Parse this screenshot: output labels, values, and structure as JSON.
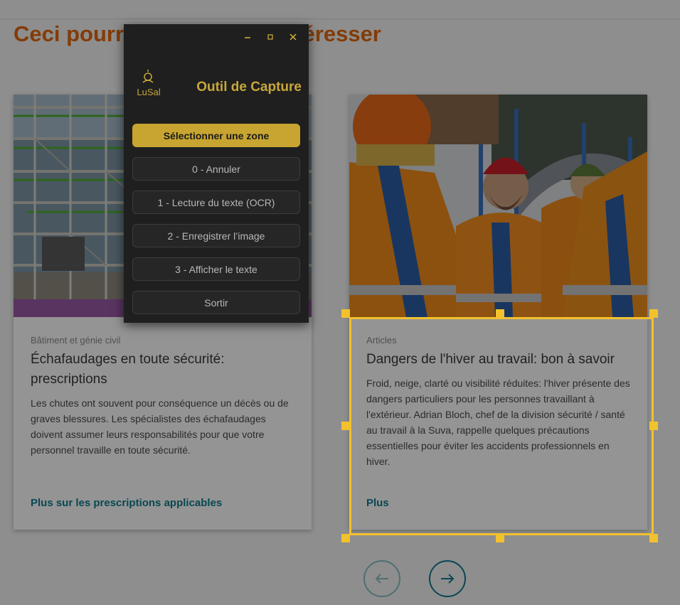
{
  "section": {
    "title": "Ceci pourrait aussi vous intéresser"
  },
  "cards": [
    {
      "category": "Bâtiment et génie civil",
      "title": "Échafaudages en toute sécurité: prescriptions",
      "text": "Les chutes ont souvent pour conséquence un décès ou de graves blessures. Les spécialistes des échafaudages doivent assumer leurs responsabilités pour que votre personnel travaille en toute sécurité.",
      "link": "Plus sur les prescriptions applicables",
      "image": "scaffolding-building-photo"
    },
    {
      "category": "Articles",
      "title": "Dangers de l'hiver au travail: bon à savoir",
      "text": "Froid, neige, clarté ou visibilité réduites: l'hiver présente des dangers particuliers pour les personnes travaillant à l'extérieur. Adrian Bloch, chef de la division sécurité / santé au travail à la Suva, rappelle quelques précautions essentielles pour éviter les accidents professionnels en hiver.",
      "link": "Plus",
      "image": "winter-workers-photo"
    }
  ],
  "carousel": {
    "prev_icon": "arrow-left-icon",
    "next_icon": "arrow-right-icon"
  },
  "capture_tool": {
    "brand": "LuSal",
    "title": "Outil de Capture",
    "buttons": {
      "select": "Sélectionner une zone",
      "cancel": "0 - Annuler",
      "ocr": "1 - Lecture du texte (OCR)",
      "save": "2 - Enregistrer l’image",
      "show": "3 - Afficher le texte",
      "exit": "Sortir"
    },
    "window_controls": [
      "minimize-icon",
      "maximize-icon",
      "close-icon"
    ]
  },
  "colors": {
    "section_title": "#e2680f",
    "link": "#0e7c8c",
    "tool_accent": "#c8a531",
    "selection": "#f2c12e",
    "tool_bg": "#1f1f1f"
  }
}
